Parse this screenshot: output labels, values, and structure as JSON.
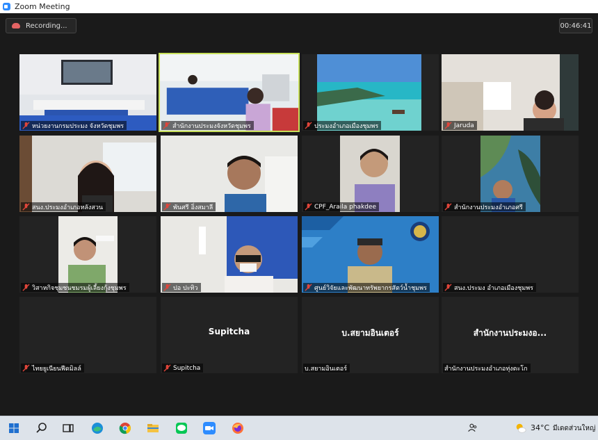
{
  "window": {
    "title": "Zoom Meeting"
  },
  "meeting": {
    "recording_label": "Recording...",
    "elapsed": "00:46:41"
  },
  "tiles": [
    {
      "label": "หน่วยงานกรมประมง จังหวัดชุมพร",
      "muted": true
    },
    {
      "label": "สำนักงานประมงจังหวัดชุมพร",
      "muted": true,
      "active_speaker": true
    },
    {
      "label": "ประมงอำเภอเมืองชุมพร",
      "muted": true
    },
    {
      "label": "Jaruda",
      "muted": true
    },
    {
      "label": "สนง.ประมงอำเภอหลังสวน",
      "muted": true
    },
    {
      "label": "พันศรี อิ่งสมาลี",
      "muted": true
    },
    {
      "label": "CPF_Araila phakdee",
      "muted": true
    },
    {
      "label": "สำนักงานประมงอำเภอศรี",
      "muted": true
    },
    {
      "label": "วิสาหกิจชุมชนชมรมผู้เลี้ยงกุ้งชุมพร",
      "muted": true
    },
    {
      "label": "ปอ ปะทิว",
      "muted": true
    },
    {
      "label": "ศูนย์วิจัยและพัฒนาทรัพยากรสัตว์น้ำชุมพร",
      "muted": true
    },
    {
      "label": "สนง.ประมง อำเภอเมืองชุมพร",
      "muted": true
    },
    {
      "label": "ไทยยูเนียนฟีดมิลล์",
      "muted": true,
      "display_name": ""
    },
    {
      "label": "Supitcha",
      "muted": true,
      "display_name": "Supitcha"
    },
    {
      "label": "บ.สยามอินเตอร์",
      "muted": false,
      "display_name": "บ.สยามอินเตอร์"
    },
    {
      "label": "สำนักงานประมงอำเภอทุ่งตะโก",
      "muted": false,
      "display_name": "สำนักงานประมงอ..."
    }
  ],
  "taskbar": {
    "apps": [
      "windows-start",
      "search",
      "task-view",
      "edge",
      "chrome",
      "file-explorer",
      "line",
      "zoom",
      "firefox"
    ],
    "weather": {
      "temp": "34°C",
      "place": "มีเดดส่วนใหญ่"
    }
  },
  "colors": {
    "active_speaker_border": "#c8e05a",
    "mute_icon": "#e0453a",
    "zoom_blue": "#2d8cff"
  }
}
